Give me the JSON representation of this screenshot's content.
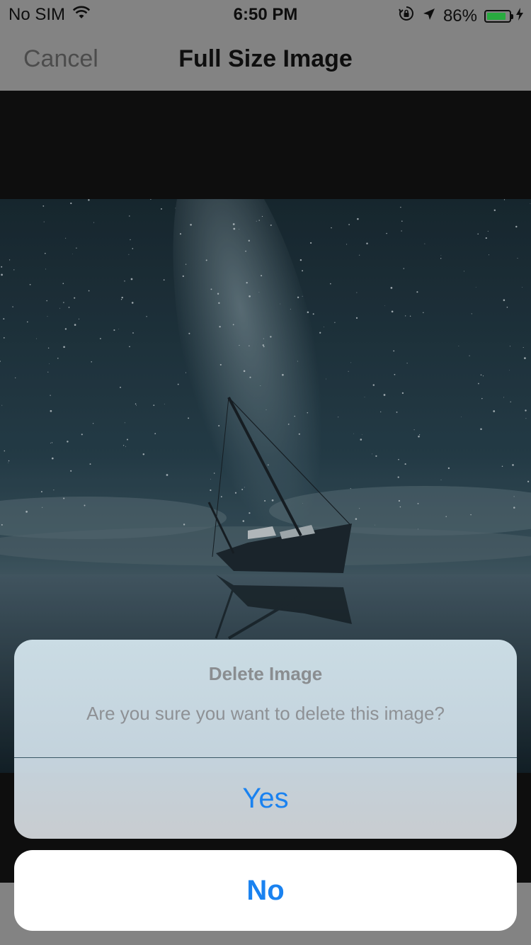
{
  "status_bar": {
    "carrier": "No SIM",
    "time": "6:50 PM",
    "battery_percent": "86%",
    "battery_level": 0.86,
    "icons": [
      "wifi-icon",
      "orientation-lock-icon",
      "location-arrow-icon",
      "battery-icon",
      "charging-bolt-icon"
    ],
    "battery_color": "#2fc84a"
  },
  "nav_bar": {
    "cancel_label": "Cancel",
    "title": "Full Size Image"
  },
  "image": {
    "subject": "photo"
  },
  "action_sheet": {
    "title": "Delete Image",
    "message": "Are you sure you want to delete this image?",
    "confirm_label": "Yes",
    "cancel_label": "No",
    "accent_color": "#1a82f0"
  }
}
